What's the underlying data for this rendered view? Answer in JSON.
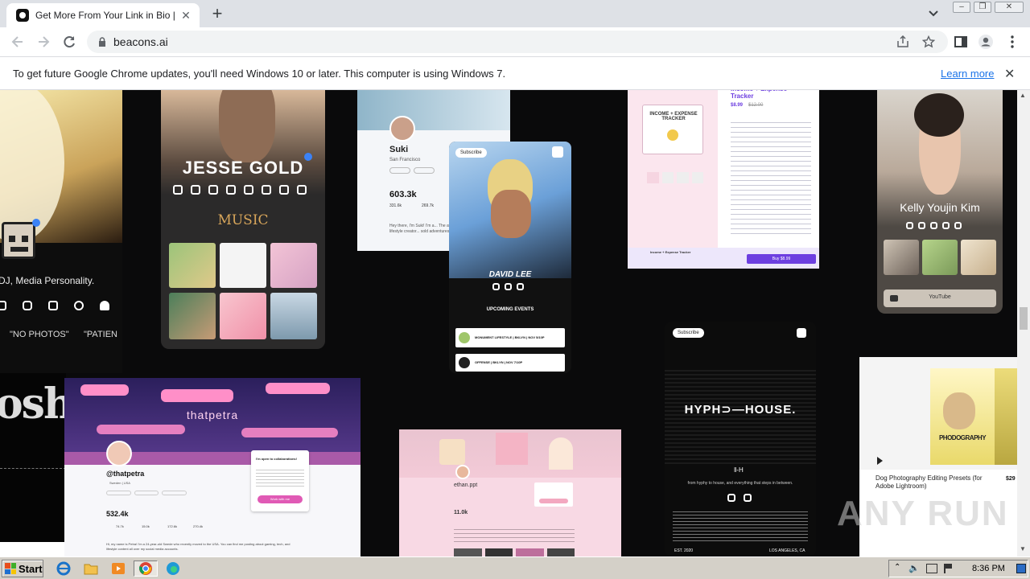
{
  "browser": {
    "tab_title": "Get More From Your Link in Bio | Bea",
    "url": "beacons.ai",
    "infobar_message": "To get future Google Chrome updates, you'll need Windows 10 or later. This computer is using Windows 7.",
    "infobar_link": "Learn more"
  },
  "cards": {
    "left_creator": {
      "subtitle": "DJ, Media Personality.",
      "chip1": "\"NO PHOTOS\"",
      "chip2": "\"PATIEN",
      "brand_text": "osh"
    },
    "jesse": {
      "name": "JESSE GOLD",
      "section": "MUSIC"
    },
    "suki": {
      "name": "Suki",
      "location": "San Francisco",
      "followers": "603.3k",
      "stat1": "331.6k",
      "stat2": "269.7k",
      "bio": "Hey there, I'm Suki! I'm a... The awesome lifestyle creator... sold adventures, and..."
    },
    "david": {
      "subscribe": "Subscribe",
      "name": "DAVID LEE",
      "events_title": "UPCOMING EVENTS",
      "event1": "MONUMENT LIFESTYLE | BKLYN | NOV 5/10P",
      "event2": "OFFENSE | BKLYN | NOV 7/10P"
    },
    "tracker": {
      "title": "Income + Expense Tracker",
      "price": "$8.99",
      "old_price": "$12.00",
      "image_label": "INCOME + EXPENSE TRACKER",
      "bottom_label": "Income + Expense Tracker",
      "buy": "Buy $8.99"
    },
    "kelly": {
      "name": "Kelly Youjin Kim",
      "youtube": "YouTube"
    },
    "petra": {
      "banner": "thatpetra",
      "handle": "@thatpetra",
      "location": "Sweden | USA",
      "followers": "532.4k",
      "stat1": "74.7k",
      "stat2": "15.0k",
      "stat3": "172.6k",
      "stat4": "270.4k",
      "popup_title": "I'm open to collaborations!",
      "popup_button": "Work with me",
      "bio": "Hi, my name is Petra! I'm a 24-year-old Swede who recently moved to the USA. You can find me posting about gaming, tech, and lifestyle content all over my social media accounts."
    },
    "ethan": {
      "handle": "ethan.ppt",
      "followers": "11.0k"
    },
    "hyph": {
      "subscribe": "Subscribe",
      "brand": "HYPH⊃—HOUSE.",
      "tagline": "from hyphy to house, and everything that steps in between.",
      "footer_left": "EST. 2020",
      "footer_right": "LOS ANGELES, CA"
    },
    "dog": {
      "product": "Dog Photography Editing Presets (for Adobe Lightroom)",
      "price": "$29",
      "cover_text": "PHODOGRAPHY"
    }
  },
  "watermark": "ANY RUN",
  "taskbar": {
    "start": "Start",
    "time": "8:36 PM"
  }
}
